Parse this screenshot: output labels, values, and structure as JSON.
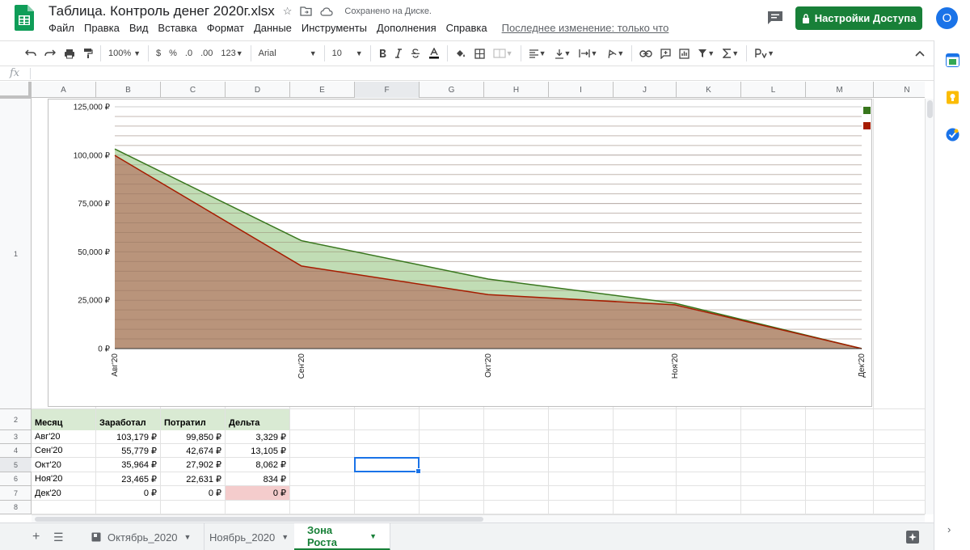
{
  "header": {
    "title": "Таблица. Контроль денег 2020г.xlsx",
    "saved_status": "Сохранено на Диске.",
    "share_label": "Настройки Доступа",
    "avatar_letter": "O",
    "last_edit": "Последнее изменение: только что",
    "menu": [
      "Файл",
      "Правка",
      "Вид",
      "Вставка",
      "Формат",
      "Данные",
      "Инструменты",
      "Дополнения",
      "Справка"
    ]
  },
  "toolbar": {
    "zoom": "100%",
    "currency": "$",
    "percent": "%",
    "dec_less": ".0",
    "dec_more": ".00",
    "format_more": "123",
    "font": "Arial",
    "font_size": "10"
  },
  "formula_bar": {
    "fx": "fx",
    "value": ""
  },
  "grid": {
    "columns": [
      "A",
      "B",
      "C",
      "D",
      "E",
      "F",
      "G",
      "H",
      "I",
      "J",
      "K",
      "L",
      "M",
      "N"
    ],
    "selected_column": "F",
    "rows": [
      "1",
      "2",
      "3",
      "4",
      "5",
      "6",
      "7",
      "8"
    ],
    "selected_row": "5",
    "table_headers": [
      "Месяц",
      "Заработал",
      "Потратил",
      "Дельта"
    ],
    "table_rows": [
      [
        "Авг'20",
        "103,179 ₽",
        "99,850 ₽",
        "3,329 ₽"
      ],
      [
        "Сен'20",
        "55,779 ₽",
        "42,674 ₽",
        "13,105 ₽"
      ],
      [
        "Окт'20",
        "35,964 ₽",
        "27,902 ₽",
        "8,062 ₽"
      ],
      [
        "Ноя'20",
        "23,465 ₽",
        "22,631 ₽",
        "834 ₽"
      ],
      [
        "Дек'20",
        "0 ₽",
        "0 ₽",
        "0 ₽"
      ]
    ]
  },
  "chart_data": {
    "type": "area",
    "categories": [
      "Авг'20",
      "Сен'20",
      "Окт'20",
      "Ноя'20",
      "Дек'20"
    ],
    "series": [
      {
        "values": [
          103179,
          55779,
          35964,
          23465,
          0
        ],
        "color": "#38761d",
        "fill": "#b6d7a8"
      },
      {
        "values": [
          99850,
          42674,
          27902,
          22631,
          0
        ],
        "color": "#a61c00",
        "fill": "#b88c74"
      }
    ],
    "y_ticks": [
      "0 ₽",
      "25,000 ₽",
      "50,000 ₽",
      "75,000 ₽",
      "100,000 ₽",
      "125,000 ₽"
    ],
    "ylim": [
      0,
      125000
    ],
    "grid": true,
    "legend": "top-right"
  },
  "sheets": {
    "tabs": [
      {
        "label": "Октябрь_2020",
        "active": false
      },
      {
        "label": "Ноябрь_2020",
        "active": false
      },
      {
        "label": "Зона Роста",
        "active": true
      }
    ]
  },
  "colors": {
    "accent": "#188038",
    "selection": "#1a73e8",
    "header_fill": "#d9ead3",
    "alert_fill": "#f4cccc"
  }
}
